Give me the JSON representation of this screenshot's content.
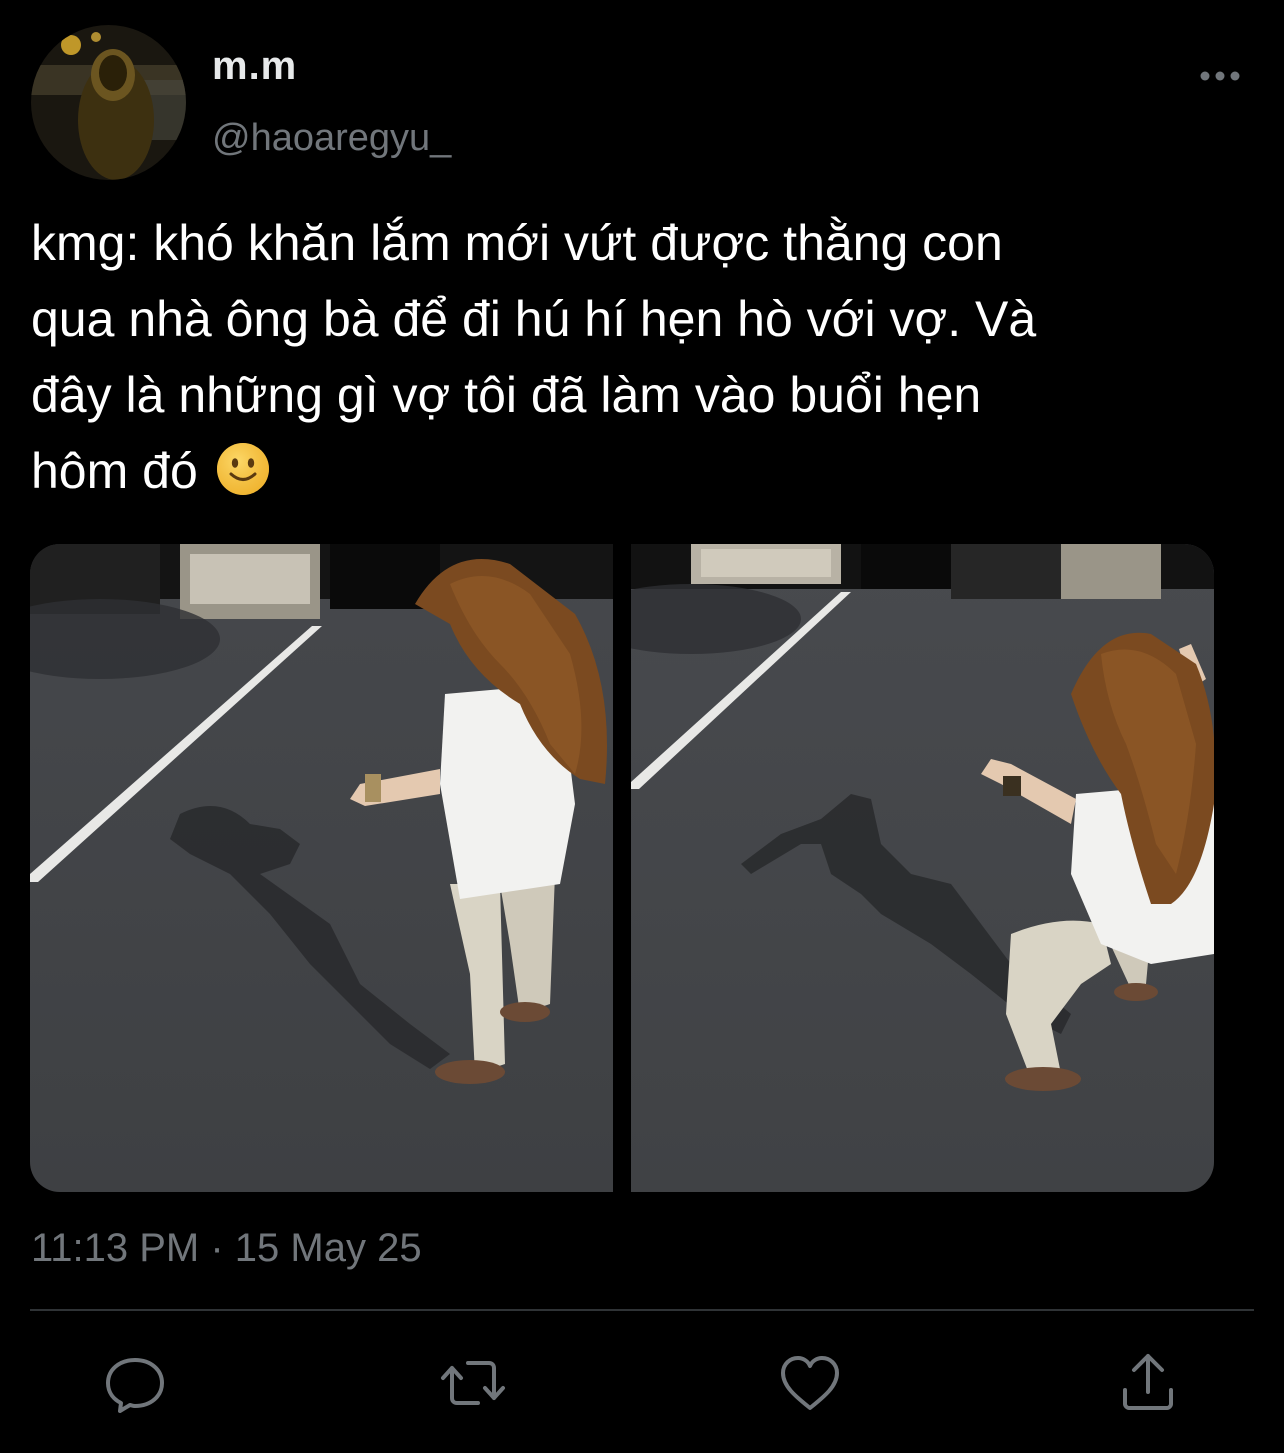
{
  "tweet": {
    "display_name": "m.m",
    "handle": "@haoaregyu_",
    "text": "kmg: khó khăn lắm mới vứt được thằng con\nqua nhà ông bà để đi hú hí hẹn hò với vợ. Và\nđây là những gì vợ tôi đã làm vào buổi hẹn\nhôm đó",
    "emoji": "slightly-smiling-face",
    "timestamp": "11:13 PM · 15 May 25",
    "photo_count": 2
  },
  "icons": {
    "more": "more-dots-icon",
    "reply": "reply-icon",
    "retweet": "retweet-icon",
    "like": "like-icon",
    "share": "share-icon"
  },
  "colors": {
    "background": "#000000",
    "text": "#ffffff",
    "secondary": "#71767b",
    "divider": "#2f3336"
  }
}
